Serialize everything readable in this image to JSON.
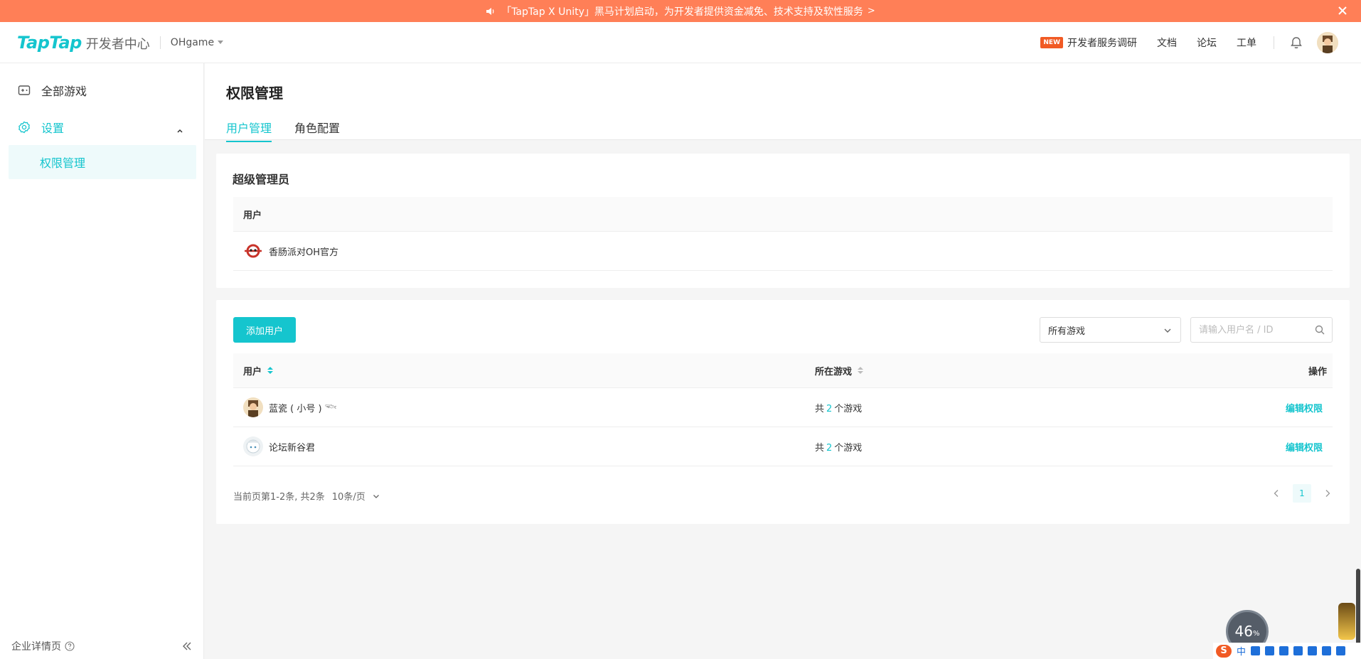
{
  "banner": {
    "text": "「TapTap X Unity」黑马计划启动，为开发者提供资金减免、技术支持及软性服务",
    "arrow": ">"
  },
  "header": {
    "brand": "TapTap",
    "subtitle": "开发者中心",
    "org": "OHgame",
    "new_badge": "NEW",
    "links": {
      "survey": "开发者服务调研",
      "docs": "文档",
      "forum": "论坛",
      "ticket": "工单"
    }
  },
  "sidebar": {
    "all_games": "全部游戏",
    "settings": "设置",
    "permissions": "权限管理",
    "footer": "企业详情页"
  },
  "page": {
    "title": "权限管理",
    "tabs": [
      "用户管理",
      "角色配置"
    ]
  },
  "super_admin": {
    "title": "超级管理员",
    "column": "用户",
    "rows": [
      {
        "name": "香肠派对OH官方"
      }
    ]
  },
  "users": {
    "add_button": "添加用户",
    "game_filter": "所有游戏",
    "search_placeholder": "请输入用户名 / ID",
    "columns": {
      "user": "用户",
      "games": "所在游戏",
      "actions": "操作"
    },
    "rows": [
      {
        "name": "蓝瓷 ( 小号 ) 𓆝",
        "games_prefix": "共",
        "games_count": "2",
        "games_suffix": "个游戏",
        "action": "编辑权限"
      },
      {
        "name": "论坛新谷君",
        "games_prefix": "共",
        "games_count": "2",
        "games_suffix": "个游戏",
        "action": "编辑权限"
      }
    ],
    "pagination": {
      "summary": "当前页第1-2条, 共2条",
      "per_page": "10条/页",
      "current_page": "1"
    }
  },
  "widgets": {
    "speed_value": "46",
    "speed_unit": "%",
    "ime_label": "中"
  },
  "colors": {
    "accent": "#15c5ce",
    "banner": "#ff7f57",
    "new_badge": "#f15a24"
  }
}
